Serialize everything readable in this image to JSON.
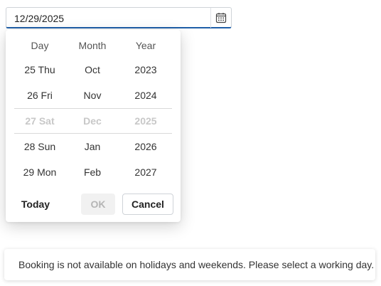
{
  "date_input": {
    "value": "12/29/2025",
    "icon": "calendar-icon"
  },
  "picker": {
    "headers": {
      "day": "Day",
      "month": "Month",
      "year": "Year"
    },
    "days": [
      "25 Thu",
      "26 Fri",
      "27 Sat",
      "28 Sun",
      "29 Mon"
    ],
    "months": [
      "Oct",
      "Nov",
      "Dec",
      "Jan",
      "Feb"
    ],
    "years": [
      "2023",
      "2024",
      "2025",
      "2026",
      "2027"
    ],
    "selected_index": 2,
    "buttons": {
      "today": "Today",
      "ok": "OK",
      "cancel": "Cancel"
    }
  },
  "toast": {
    "message": "Booking is not available on holidays and weekends. Please select a working day."
  }
}
